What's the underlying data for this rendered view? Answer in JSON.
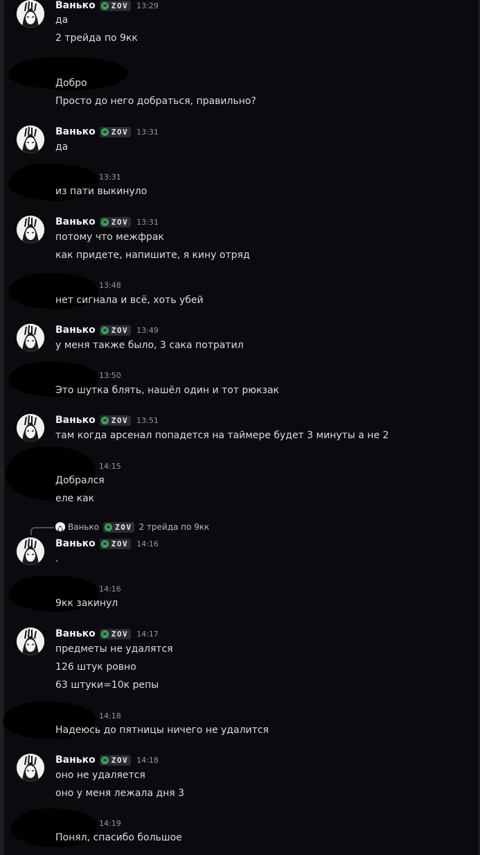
{
  "user": {
    "name": "Ванько",
    "tag": "ZOV"
  },
  "m1": {
    "time": "13:29",
    "l1": "да",
    "l2": "2 трейда по 9кк"
  },
  "m2": {
    "l1": "Добро",
    "l2": "Просто до него добраться, правильно?"
  },
  "m3": {
    "time": "13:31",
    "l1": "да"
  },
  "m4": {
    "time": "13:31",
    "l1": "из пати выкинуло"
  },
  "m5": {
    "time": "13:31",
    "l1": "потому что межфрак",
    "l2": "как придете, напишите, я кину отряд"
  },
  "m6": {
    "time": "13:48",
    "l1": "нет сигнала и всё, хоть убей"
  },
  "m7": {
    "time": "13:49",
    "l1": "у меня также было, 3 сака потратил"
  },
  "m8": {
    "time": "13:50",
    "l1": "Это шутка блять,  нашёл один и тот рюкзак"
  },
  "m9": {
    "time": "13:51",
    "l1": "там когда арсенал попадется на таймере будет 3 минуты а не 2"
  },
  "m10": {
    "time": "14:15",
    "l1": "Добрался",
    "l2": "еле как"
  },
  "reply": {
    "text": "2 трейда по 9кк"
  },
  "m11": {
    "time": "14:16",
    "l1": "."
  },
  "m12": {
    "time": "14:16",
    "l1": "9кк закинул"
  },
  "m13": {
    "time": "14:17",
    "l1": "предметы не удалятся",
    "l2": "126 штук ровно",
    "l3": "63 штуки=10к репы"
  },
  "m14": {
    "time": "14:18",
    "l1": "Надеюсь до пятницы ничего не удалится"
  },
  "m15": {
    "time": "14:18",
    "l1": "оно не удаляется",
    "l2": "оно у меня лежала дня 3"
  },
  "m16": {
    "time": "14:19",
    "l1": "Понял, спасибо большое"
  }
}
